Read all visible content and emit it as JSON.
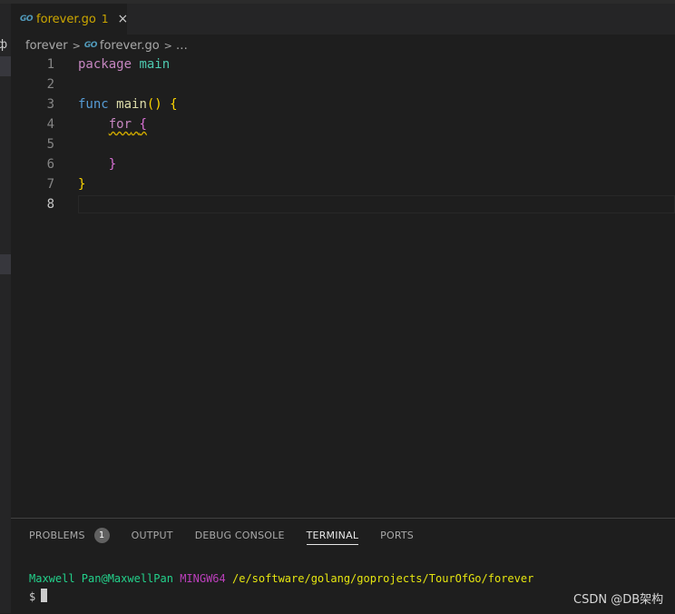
{
  "tab": {
    "go_badge": "GO",
    "title": "forever.go",
    "problem_count": "1",
    "close": "×"
  },
  "breadcrumb": {
    "folder": "forever",
    "file": "forever.go",
    "more": "…",
    "go_badge": "GO"
  },
  "editor": {
    "lines": [
      {
        "num": "1"
      },
      {
        "num": "2"
      },
      {
        "num": "3"
      },
      {
        "num": "4"
      },
      {
        "num": "5"
      },
      {
        "num": "6"
      },
      {
        "num": "7"
      },
      {
        "num": "8"
      }
    ],
    "tokens": {
      "l1_kw": "package",
      "l1_name": "main",
      "l3_kw": "func",
      "l3_fn": "main",
      "l3_paren": "()",
      "l3_brace": "{",
      "l4_kw": "for",
      "l4_brace": "{",
      "l6_brace": "}",
      "l7_brace": "}"
    }
  },
  "panel": {
    "tabs": [
      "PROBLEMS",
      "OUTPUT",
      "DEBUG CONSOLE",
      "TERMINAL",
      "PORTS"
    ],
    "problems_badge": "1",
    "active_tab": "TERMINAL"
  },
  "terminal": {
    "user": "Maxwell Pan@MaxwellPan",
    "system": "MINGW64",
    "path": "/e/software/golang/goprojects/TourOfGo/forever",
    "prompt": "$"
  },
  "watermark": "CSDN @DB架构",
  "colors": {
    "keyword": "#c586c0",
    "function": "#dcdcaa",
    "bracket": "#ffd700",
    "type": "#4ec9b0",
    "warning": "#cca700"
  }
}
